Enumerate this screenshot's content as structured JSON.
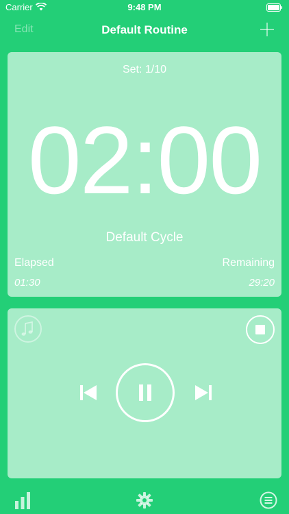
{
  "status_bar": {
    "carrier": "Carrier",
    "time": "9:48 PM",
    "icons": [
      "wifi-icon",
      "battery-icon"
    ]
  },
  "nav": {
    "edit_label": "Edit",
    "title": "Default Routine",
    "add_icon": "plus-icon"
  },
  "timer": {
    "set_label": "Set: 1/10",
    "display": "02:00",
    "cycle_name": "Default Cycle",
    "elapsed_label": "Elapsed",
    "elapsed_value": "01:30",
    "remaining_label": "Remaining",
    "remaining_value": "29:20"
  },
  "player": {
    "icons": [
      "music-note-icon",
      "stop-icon",
      "skip-back-icon",
      "pause-icon",
      "skip-forward-icon"
    ]
  },
  "tab_bar": {
    "icons": [
      "bar-chart-icon",
      "gear-icon",
      "list-icon"
    ]
  },
  "colors": {
    "background": "#23cf77",
    "card": "#a6ecc8",
    "foreground": "#ffffff"
  }
}
